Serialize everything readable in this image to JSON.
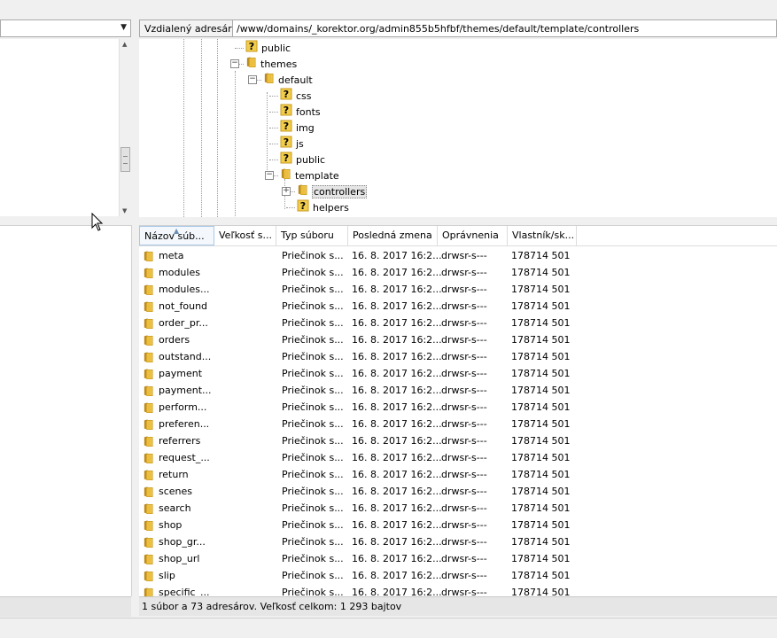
{
  "remote": {
    "address_label": "Vzdialený adresár:",
    "address_path": "/www/domains/_korektor.org/admin855b5hfbf/themes/default/template/controllers",
    "tree": [
      {
        "label": "public",
        "type": "unknown"
      },
      {
        "label": "themes",
        "type": "folder"
      },
      {
        "label": "default",
        "type": "folder"
      },
      {
        "label": "css",
        "type": "unknown"
      },
      {
        "label": "fonts",
        "type": "unknown"
      },
      {
        "label": "img",
        "type": "unknown"
      },
      {
        "label": "js",
        "type": "unknown"
      },
      {
        "label": "public",
        "type": "unknown"
      },
      {
        "label": "template",
        "type": "folder"
      },
      {
        "label": "controllers",
        "type": "folder",
        "selected": true
      },
      {
        "label": "helpers",
        "type": "unknown"
      }
    ],
    "columns": [
      "Názov súb...",
      "Veľkosť s...",
      "Typ súboru",
      "Posledná zmena",
      "Oprávnenia",
      "Vlastník/sk..."
    ],
    "files": [
      {
        "name": "meta",
        "type": "Priečinok s...",
        "modified": "16. 8. 2017 16:2...",
        "perms": "drwsr-s---",
        "owner": "178714 501"
      },
      {
        "name": "modules",
        "type": "Priečinok s...",
        "modified": "16. 8. 2017 16:2...",
        "perms": "drwsr-s---",
        "owner": "178714 501"
      },
      {
        "name": "modules...",
        "type": "Priečinok s...",
        "modified": "16. 8. 2017 16:2...",
        "perms": "drwsr-s---",
        "owner": "178714 501"
      },
      {
        "name": "not_found",
        "type": "Priečinok s...",
        "modified": "16. 8. 2017 16:2...",
        "perms": "drwsr-s---",
        "owner": "178714 501"
      },
      {
        "name": "order_pr...",
        "type": "Priečinok s...",
        "modified": "16. 8. 2017 16:2...",
        "perms": "drwsr-s---",
        "owner": "178714 501"
      },
      {
        "name": "orders",
        "type": "Priečinok s...",
        "modified": "16. 8. 2017 16:2...",
        "perms": "drwsr-s---",
        "owner": "178714 501"
      },
      {
        "name": "outstand...",
        "type": "Priečinok s...",
        "modified": "16. 8. 2017 16:2...",
        "perms": "drwsr-s---",
        "owner": "178714 501"
      },
      {
        "name": "payment",
        "type": "Priečinok s...",
        "modified": "16. 8. 2017 16:2...",
        "perms": "drwsr-s---",
        "owner": "178714 501"
      },
      {
        "name": "payment...",
        "type": "Priečinok s...",
        "modified": "16. 8. 2017 16:2...",
        "perms": "drwsr-s---",
        "owner": "178714 501"
      },
      {
        "name": "perform...",
        "type": "Priečinok s...",
        "modified": "16. 8. 2017 16:2...",
        "perms": "drwsr-s---",
        "owner": "178714 501"
      },
      {
        "name": "preferen...",
        "type": "Priečinok s...",
        "modified": "16. 8. 2017 16:2...",
        "perms": "drwsr-s---",
        "owner": "178714 501"
      },
      {
        "name": "referrers",
        "type": "Priečinok s...",
        "modified": "16. 8. 2017 16:2...",
        "perms": "drwsr-s---",
        "owner": "178714 501"
      },
      {
        "name": "request_...",
        "type": "Priečinok s...",
        "modified": "16. 8. 2017 16:2...",
        "perms": "drwsr-s---",
        "owner": "178714 501"
      },
      {
        "name": "return",
        "type": "Priečinok s...",
        "modified": "16. 8. 2017 16:2...",
        "perms": "drwsr-s---",
        "owner": "178714 501"
      },
      {
        "name": "scenes",
        "type": "Priečinok s...",
        "modified": "16. 8. 2017 16:2...",
        "perms": "drwsr-s---",
        "owner": "178714 501"
      },
      {
        "name": "search",
        "type": "Priečinok s...",
        "modified": "16. 8. 2017 16:2...",
        "perms": "drwsr-s---",
        "owner": "178714 501"
      },
      {
        "name": "shop",
        "type": "Priečinok s...",
        "modified": "16. 8. 2017 16:2...",
        "perms": "drwsr-s---",
        "owner": "178714 501"
      },
      {
        "name": "shop_gr...",
        "type": "Priečinok s...",
        "modified": "16. 8. 2017 16:2...",
        "perms": "drwsr-s---",
        "owner": "178714 501"
      },
      {
        "name": "shop_url",
        "type": "Priečinok s...",
        "modified": "16. 8. 2017 16:2...",
        "perms": "drwsr-s---",
        "owner": "178714 501"
      },
      {
        "name": "slip",
        "type": "Priečinok s...",
        "modified": "16. 8. 2017 16:2...",
        "perms": "drwsr-s---",
        "owner": "178714 501"
      },
      {
        "name": "specific_...",
        "type": "Priečinok s...",
        "modified": "16. 8. 2017 16:2...",
        "perms": "drwsr-s---",
        "owner": "178714 501"
      }
    ],
    "status": "1 súbor a 73 adresárov. Veľkosť celkom: 1 293 bajtov"
  },
  "icons": {
    "folder": "folder-icon",
    "unknown_folder": "unknown-folder-icon",
    "combo_arrow": "chevron-down-icon"
  },
  "colors": {
    "folder_yellow": "#e8c349",
    "selection": "#e5e5e5"
  }
}
